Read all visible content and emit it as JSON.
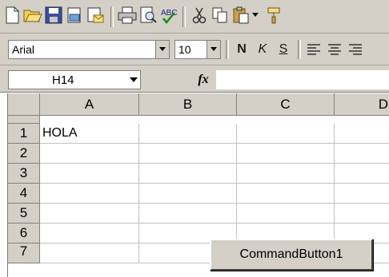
{
  "toolbar_standard": {
    "icons": [
      "new-document-icon",
      "open-folder-icon",
      "save-icon",
      "permission-icon",
      "email-icon",
      "print-icon",
      "print-preview-icon",
      "spelling-icon",
      "cut-icon",
      "copy-icon",
      "paste-icon",
      "format-painter-icon"
    ]
  },
  "toolbar_formatting": {
    "font_name": "Arial",
    "font_size": "10",
    "bold_label": "N",
    "italic_label": "K",
    "underline_label": "S"
  },
  "formula_bar": {
    "name_box": "H14",
    "fx_label": "fx",
    "formula": ""
  },
  "sheet": {
    "columns": [
      "A",
      "B",
      "C",
      "D"
    ],
    "rows": [
      "1",
      "2",
      "3",
      "4",
      "5",
      "6",
      "7"
    ],
    "cells": {
      "A1": "HOLA"
    }
  },
  "command_button": {
    "label": "CommandButton1"
  },
  "colors": {
    "chrome": "#d4d0c8",
    "gridline": "#c0c0c0"
  }
}
